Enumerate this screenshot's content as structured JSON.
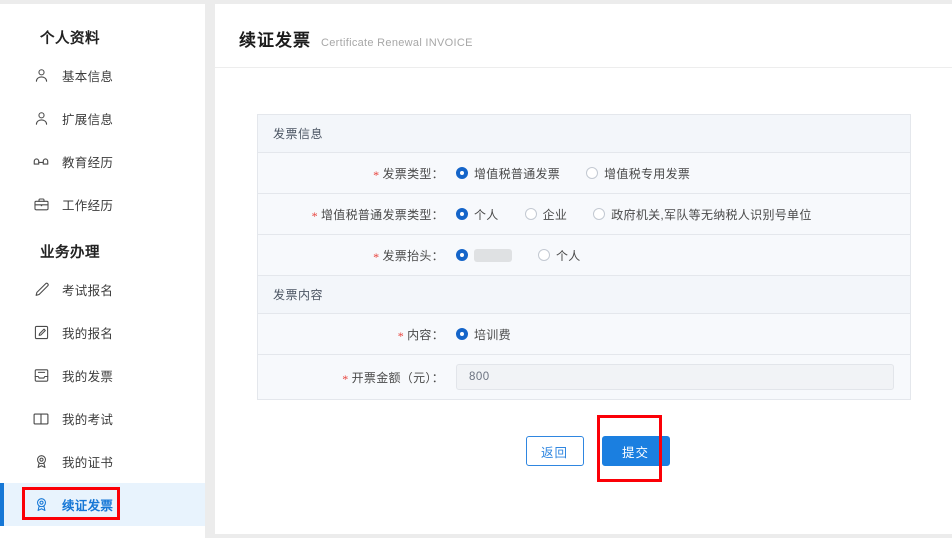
{
  "sidebar": {
    "groups": [
      {
        "title": "个人资料",
        "items": [
          {
            "label": "基本信息",
            "icon": "user-icon"
          },
          {
            "label": "扩展信息",
            "icon": "user-icon"
          },
          {
            "label": "教育经历",
            "icon": "graduation-cap-icon"
          },
          {
            "label": "工作经历",
            "icon": "briefcase-icon"
          }
        ]
      },
      {
        "title": "业务办理",
        "items": [
          {
            "label": "考试报名",
            "icon": "pencil-icon"
          },
          {
            "label": "我的报名",
            "icon": "form-edit-icon"
          },
          {
            "label": "我的发票",
            "icon": "inbox-icon"
          },
          {
            "label": "我的考试",
            "icon": "book-icon"
          },
          {
            "label": "我的证书",
            "icon": "medal-icon"
          },
          {
            "label": "续证发票",
            "icon": "medal-icon",
            "active": true
          }
        ]
      }
    ]
  },
  "header": {
    "title_zh": "续证发票",
    "title_en": "Certificate Renewal INVOICE"
  },
  "form": {
    "section_invoice_info": "发票信息",
    "section_invoice_content": "发票内容",
    "rows": {
      "invoice_type": {
        "label": "发票类型：",
        "options": [
          {
            "label": "增值税普通发票",
            "selected": true
          },
          {
            "label": "增值税专用发票",
            "selected": false
          }
        ]
      },
      "general_invoice_type": {
        "label": "增值税普通发票类型：",
        "options": [
          {
            "label": "个人",
            "selected": true
          },
          {
            "label": "企业",
            "selected": false
          },
          {
            "label": "政府机关,军队等无纳税人识别号单位",
            "selected": false
          }
        ]
      },
      "invoice_title": {
        "label": "发票抬头：",
        "options": [
          {
            "label": "",
            "selected": true,
            "redacted": true
          },
          {
            "label": "个人",
            "selected": false
          }
        ]
      },
      "content": {
        "label": "内容：",
        "options": [
          {
            "label": "培训费",
            "selected": true
          }
        ]
      },
      "amount": {
        "label": "开票金额（元）：",
        "value": "800"
      }
    }
  },
  "buttons": {
    "back": "返回",
    "submit": "提交"
  },
  "colors": {
    "accent": "#1677d6",
    "primary_button": "#1b7fe0",
    "annotation": "#fb0007",
    "required_star": "#e8413a",
    "active_bg": "#e8f3fd"
  }
}
